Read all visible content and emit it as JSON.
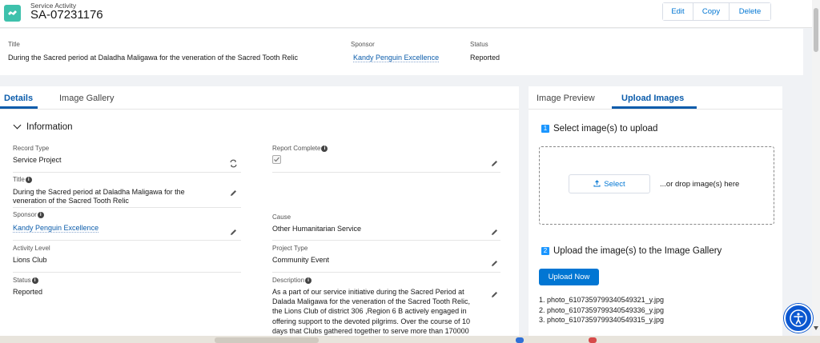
{
  "header": {
    "object_type": "Service Activity",
    "record_name": "SA-07231176",
    "buttons": {
      "edit": "Edit",
      "copy": "Copy",
      "delete": "Delete"
    }
  },
  "highlights": {
    "title_label": "Title",
    "title_value": "During the Sacred period at Daladha Maligawa for the veneration of the Sacred Tooth Relic",
    "sponsor_label": "Sponsor",
    "sponsor_value": "Kandy Penguin Excellence",
    "status_label": "Status",
    "status_value": "Reported"
  },
  "left_tabs": {
    "details": "Details",
    "gallery": "Image Gallery"
  },
  "section": {
    "title": "Information"
  },
  "fields": {
    "record_type_label": "Record Type",
    "record_type_value": "Service Project",
    "report_complete_label": "Report Complete",
    "title_label": "Title",
    "title_value_1": "During the Sacred period at Daladha Maligawa for the",
    "title_value_2": "veneration of the Sacred Tooth Relic",
    "sponsor_label": "Sponsor",
    "sponsor_value": "Kandy Penguin Excellence",
    "cause_label": "Cause",
    "cause_value": "Other Humanitarian Service",
    "activity_level_label": "Activity Level",
    "activity_level_value": "Lions Club",
    "project_type_label": "Project Type",
    "project_type_value": "Community Event",
    "status_label": "Status",
    "status_value": "Reported",
    "description_label": "Description",
    "description_lines": [
      "As a part of our service initiative during the Sacred Period at",
      "Dalada Maligawa for the veneration of the Sacred Tooth Relic,",
      "the Lions Club of district 306 ,Region 6 B actively engaged in",
      "offering support to the devoted pilgrims. Over the course of 10",
      "days that Clubs gathered together to serve more than 170000"
    ]
  },
  "right_tabs": {
    "preview": "Image Preview",
    "upload": "Upload Images"
  },
  "upload": {
    "step1_num": "1",
    "step1": "Select image(s) to upload",
    "select_button": "Select",
    "drop_text": "...or drop image(s) here",
    "step2_num": "2",
    "step2": "Upload the image(s) to the Image Gallery",
    "upload_button": "Upload Now",
    "files": [
      "1. photo_6107359799340549321_y.jpg",
      "2. photo_6107359799340549336_y.jpg",
      "3. photo_6107359799340549315_y.jpg"
    ]
  },
  "colors": {
    "brand": "#0176d3",
    "icon_teal": "#3ec1ac",
    "step_blue": "#1b96ff",
    "link": "#0b5cab"
  },
  "icons": [
    "service-activity-icon",
    "chevron-down-icon",
    "info-icon",
    "pencil-icon",
    "refresh-icon",
    "upload-icon",
    "accessibility-icon"
  ]
}
